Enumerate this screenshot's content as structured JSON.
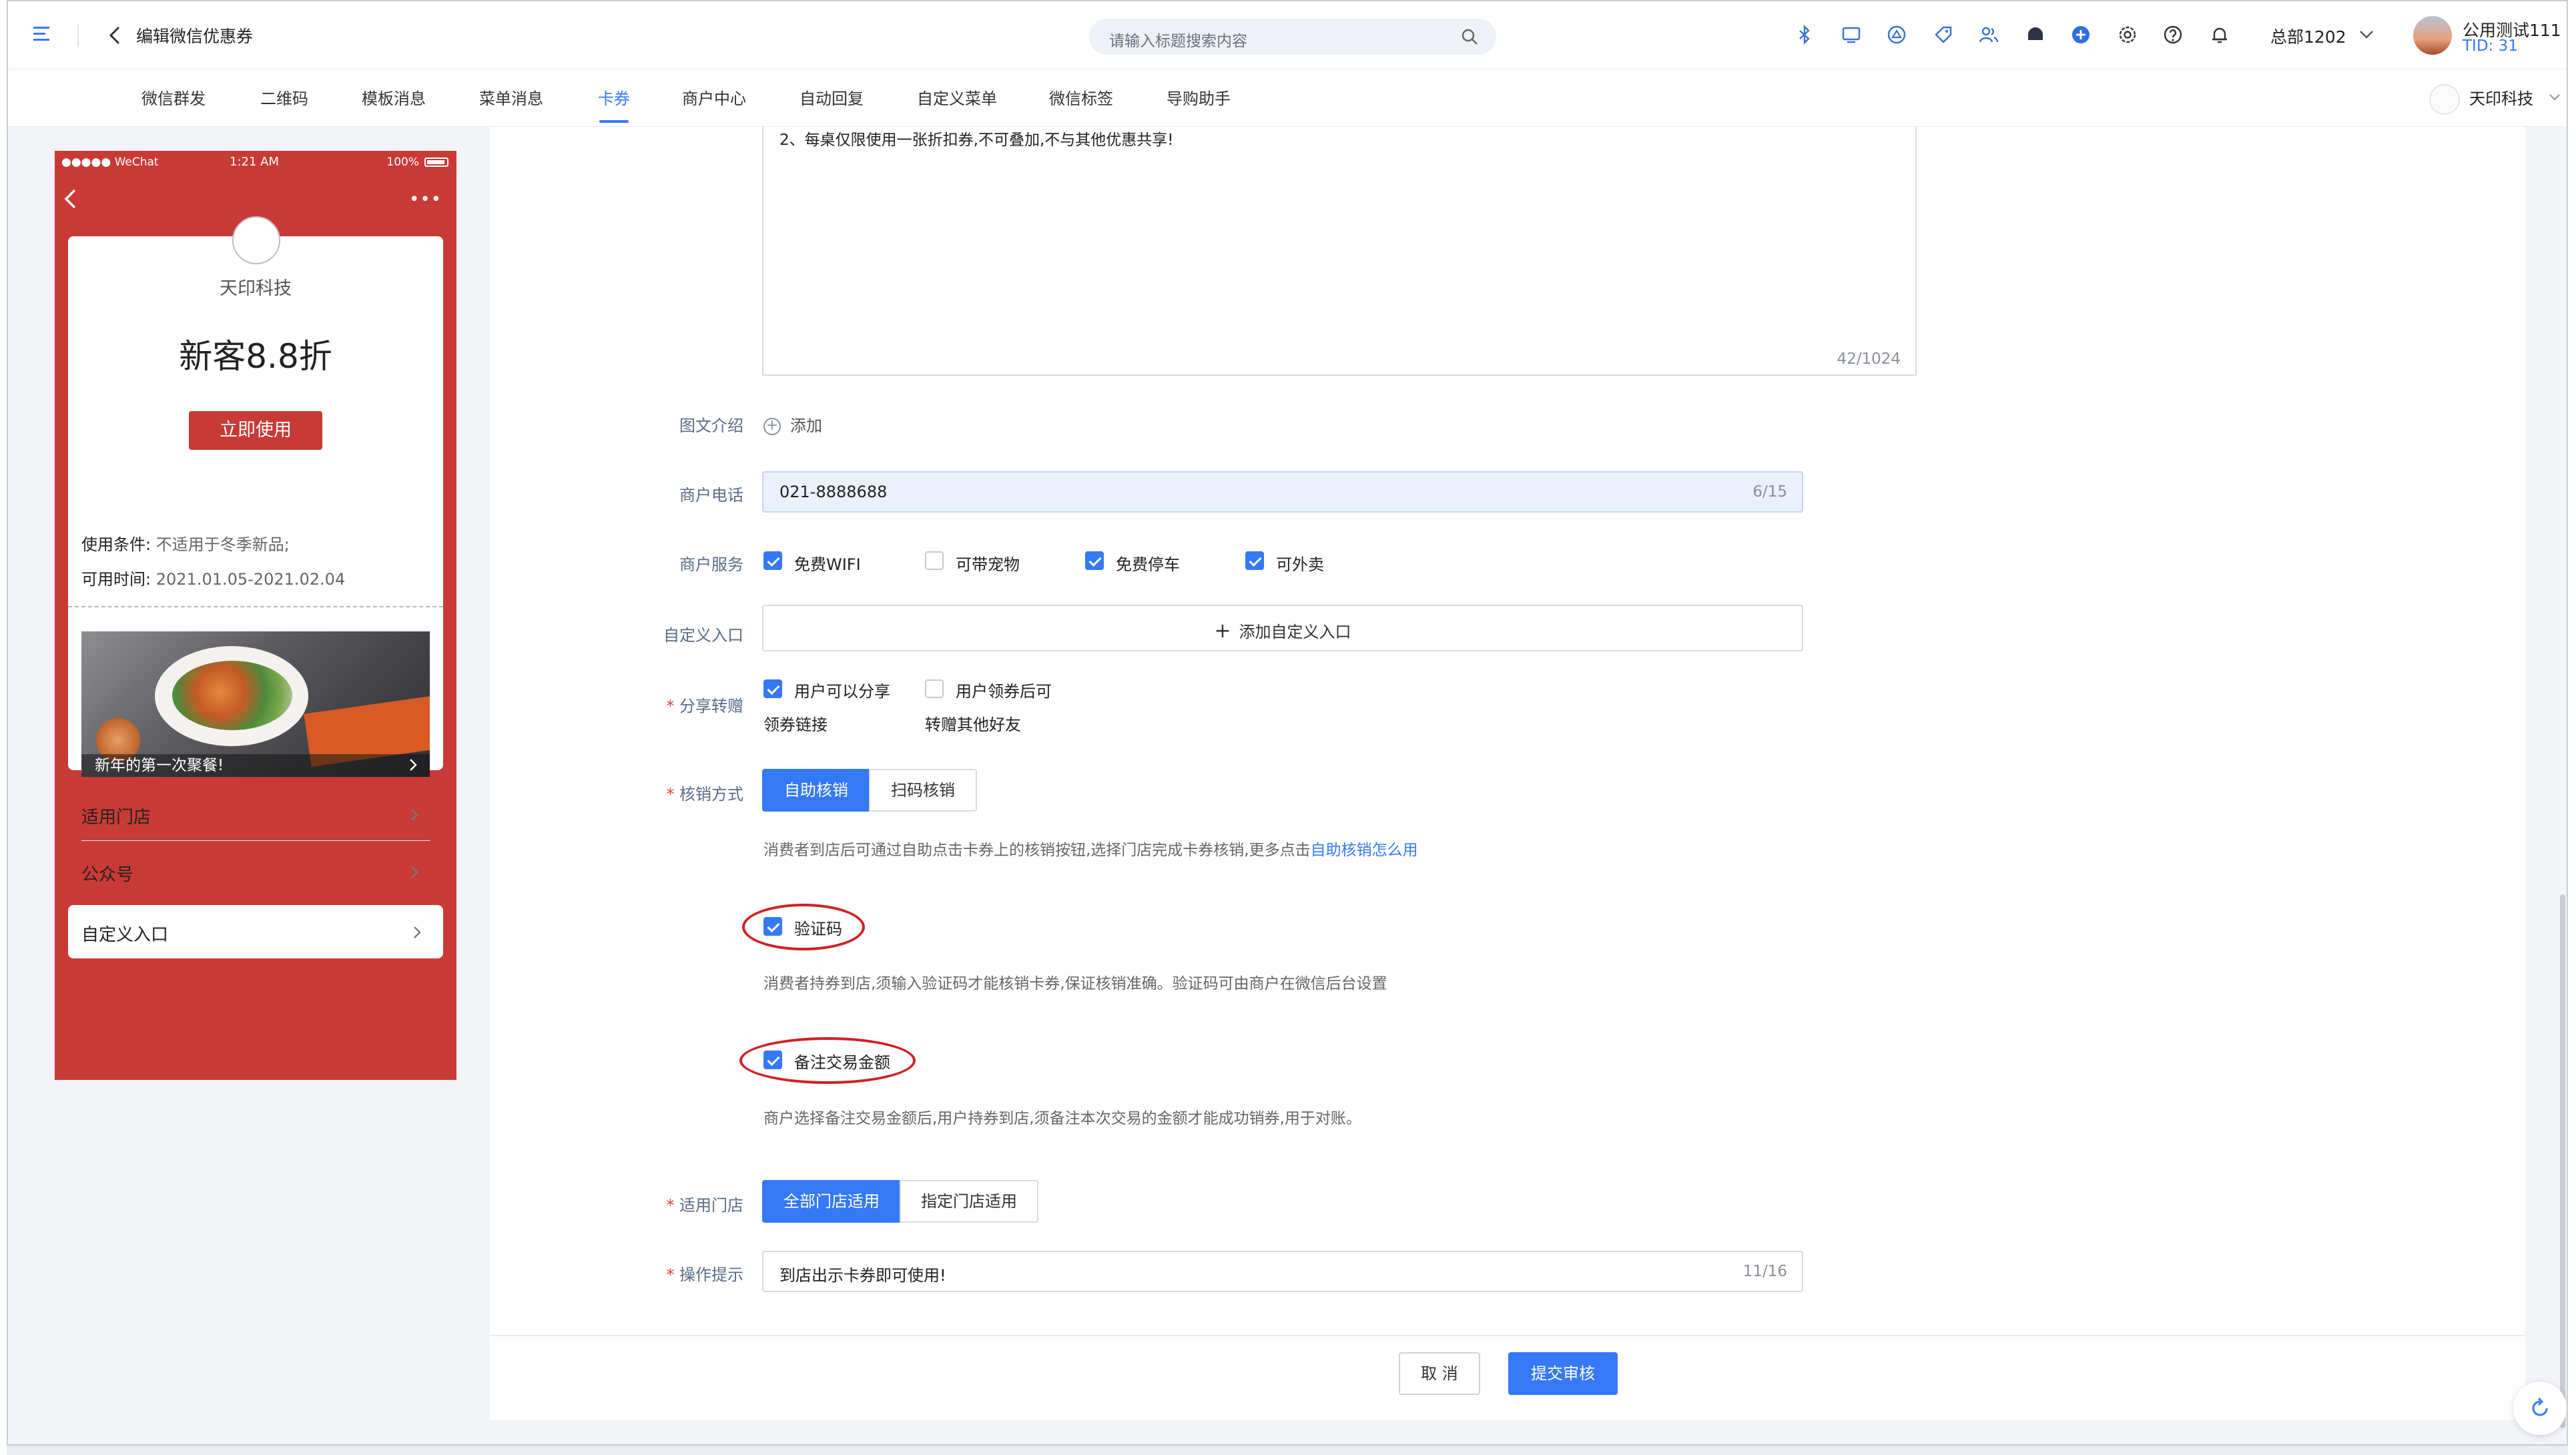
{
  "header": {
    "page_title": "编辑微信优惠券",
    "search_placeholder": "请输入标题搜索内容",
    "icons": [
      "bluetooth-icon",
      "screen-icon",
      "shop-icon",
      "tag-icon",
      "users-icon",
      "robot-icon",
      "plus-circle-icon",
      "settings-icon",
      "help-icon",
      "bell-icon"
    ],
    "org": "总部1202",
    "user_name": "公用测试111",
    "user_tid": "TID: 31"
  },
  "nav": {
    "items": [
      "微信群发",
      "二维码",
      "模板消息",
      "菜单消息",
      "卡券",
      "商户中心",
      "自动回复",
      "自定义菜单",
      "微信标签",
      "导购助手"
    ],
    "active": "卡券",
    "brand": "天印科技"
  },
  "phone": {
    "carrier": "●●●●● WeChat",
    "time": "1:21 AM",
    "battery": "100%",
    "more": "•••",
    "merchant": "天印科技",
    "coupon_title": "新客8.8折",
    "use_button": "立即使用",
    "conditions_label": "使用条件:",
    "conditions_value": "不适用于冬季新品;",
    "period_label": "可用时间:",
    "period_value": "2021.01.05-2021.02.04",
    "promo_caption": "新年的第一次聚餐!",
    "rows": [
      "适用门店",
      "公众号"
    ],
    "custom_entry": "自定义入口"
  },
  "form": {
    "textarea_text": "2、每桌仅限使用一张折扣券,不可叠加,不与其他优惠共享!",
    "textarea_count": "42/1024",
    "intro_label": "图文介绍",
    "intro_add": "添加",
    "phone_label": "商户电话",
    "phone_value": "021-8888688",
    "phone_count": "6/15",
    "service_label": "商户服务",
    "services": [
      {
        "label": "免费WIFI",
        "checked": true
      },
      {
        "label": "可带宠物",
        "checked": false
      },
      {
        "label": "免费停车",
        "checked": true
      },
      {
        "label": "可外卖",
        "checked": true
      }
    ],
    "custom_entry_label": "自定义入口",
    "custom_entry_button": "添加自定义入口",
    "share_label": "分享转赠",
    "share_options": [
      {
        "line1": "用户可以分享",
        "line2": "领券链接",
        "checked": true
      },
      {
        "line1": "用户领券后可",
        "line2": "转赠其他好友",
        "checked": false
      }
    ],
    "verify_label": "核销方式",
    "verify_options": [
      "自助核销",
      "扫码核销"
    ],
    "verify_active": "自助核销",
    "verify_hint": "消费者到店后可通过自助点击卡券上的核销按钮,选择门店完成卡券核销,更多点击",
    "verify_hint_link": "自助核销怎么用",
    "code_label": "验证码",
    "code_checked": true,
    "code_hint": "消费者持券到店,须输入验证码才能核销卡券,保证核销准确。验证码可由商户在微信后台设置",
    "amount_label": "备注交易金额",
    "amount_checked": true,
    "amount_hint": "商户选择备注交易金额后,用户持券到店,须备注本次交易的金额才能成功销券,用于对账。",
    "store_label": "适用门店",
    "store_options": [
      "全部门店适用",
      "指定门店适用"
    ],
    "store_active": "全部门店适用",
    "tip_label": "操作提示",
    "tip_value": "到店出示卡券即可使用!",
    "tip_count": "11/16"
  },
  "footer": {
    "cancel": "取 消",
    "submit": "提交审核"
  },
  "colors": {
    "primary": "#3579f6",
    "coupon_red": "#c83a36",
    "annotation_red": "#d02026"
  }
}
